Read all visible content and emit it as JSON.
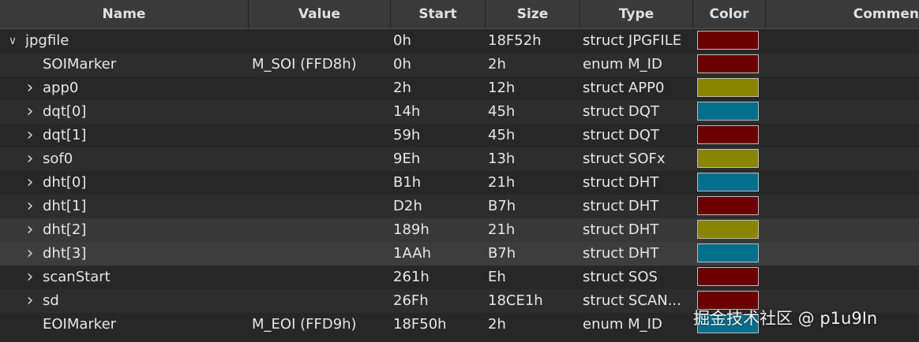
{
  "columns": [
    "Name",
    "Value",
    "Start",
    "Size",
    "Type",
    "Color",
    "Commen"
  ],
  "colors": {
    "dark_red": "#6b0000",
    "olive": "#8a8500",
    "teal": "#006f8c"
  },
  "rows": [
    {
      "name": "jpgfile",
      "value": "",
      "start": "0h",
      "size": "18F52h",
      "type": "struct JPGFILE",
      "color": "#6b0000",
      "expander": "expanded",
      "indent": 0
    },
    {
      "name": "SOIMarker",
      "value": "M_SOI (FFD8h)",
      "start": "0h",
      "size": "2h",
      "type": "enum M_ID",
      "color": "#6b0000",
      "expander": "none",
      "indent": 1
    },
    {
      "name": "app0",
      "value": "",
      "start": "2h",
      "size": "12h",
      "type": "struct APP0",
      "color": "#8a8500",
      "expander": "collapsed",
      "indent": 1
    },
    {
      "name": "dqt[0]",
      "value": "",
      "start": "14h",
      "size": "45h",
      "type": "struct DQT",
      "color": "#006f8c",
      "expander": "collapsed",
      "indent": 1
    },
    {
      "name": "dqt[1]",
      "value": "",
      "start": "59h",
      "size": "45h",
      "type": "struct DQT",
      "color": "#6b0000",
      "expander": "collapsed",
      "indent": 1
    },
    {
      "name": "sof0",
      "value": "",
      "start": "9Eh",
      "size": "13h",
      "type": "struct SOFx",
      "color": "#8a8500",
      "expander": "collapsed",
      "indent": 1
    },
    {
      "name": "dht[0]",
      "value": "",
      "start": "B1h",
      "size": "21h",
      "type": "struct DHT",
      "color": "#006f8c",
      "expander": "collapsed",
      "indent": 1
    },
    {
      "name": "dht[1]",
      "value": "",
      "start": "D2h",
      "size": "B7h",
      "type": "struct DHT",
      "color": "#6b0000",
      "expander": "collapsed",
      "indent": 1
    },
    {
      "name": "dht[2]",
      "value": "",
      "start": "189h",
      "size": "21h",
      "type": "struct DHT",
      "color": "#8a8500",
      "expander": "collapsed",
      "indent": 1
    },
    {
      "name": "dht[3]",
      "value": "",
      "start": "1AAh",
      "size": "B7h",
      "type": "struct DHT",
      "color": "#006f8c",
      "expander": "collapsed",
      "indent": 1
    },
    {
      "name": "scanStart",
      "value": "",
      "start": "261h",
      "size": "Eh",
      "type": "struct SOS",
      "color": "#6b0000",
      "expander": "collapsed",
      "indent": 1
    },
    {
      "name": "sd",
      "value": "",
      "start": "26Fh",
      "size": "18CE1h",
      "type": "struct SCAN...",
      "color": "#6b0000",
      "expander": "collapsed",
      "indent": 1
    },
    {
      "name": "EOIMarker",
      "value": "M_EOI (FFD9h)",
      "start": "18F50h",
      "size": "2h",
      "type": "enum M_ID",
      "color": "#006f8c",
      "expander": "none",
      "indent": 1
    }
  ],
  "watermark": "掘金技术社区 @ p1u9In"
}
